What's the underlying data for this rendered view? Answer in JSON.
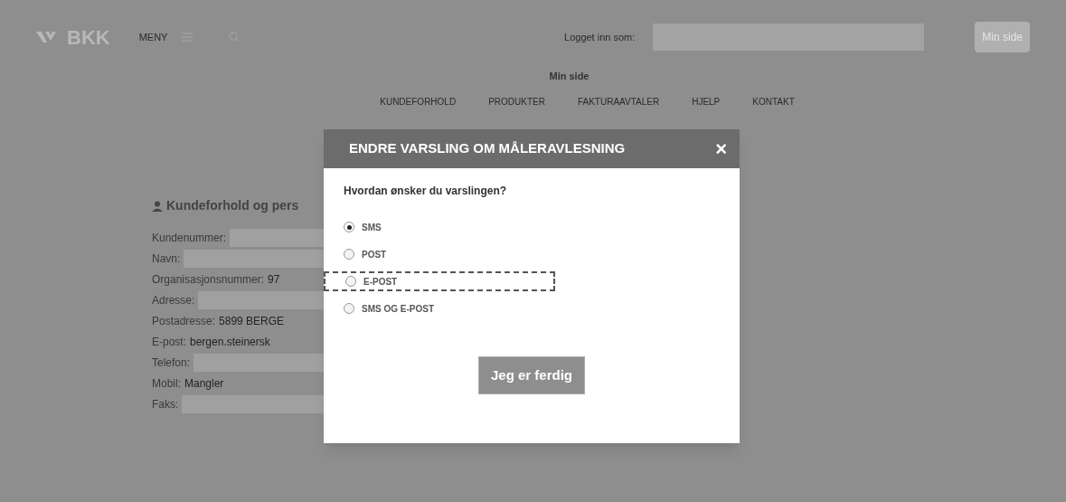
{
  "header": {
    "logo": "BKK",
    "menu": "MENY",
    "login_label": "Logget inn som:",
    "my_page": "Min side"
  },
  "breadcrumb": {
    "current": "Min side"
  },
  "nav": [
    "KUNDEFORHOLD",
    "PRODUKTER",
    "FAKTURAAVTALER",
    "HJELP",
    "KONTAKT"
  ],
  "customer": {
    "title": "Kundeforhold og pers",
    "fields": [
      {
        "label": "Kundenummer:",
        "redacted": true
      },
      {
        "label": "Navn:",
        "redacted": true
      },
      {
        "label": "Organisasjonsnummer:",
        "value": "97",
        "redacted": false
      },
      {
        "label": "Adresse:",
        "redacted": true
      },
      {
        "label": "Postadresse:",
        "value": "5899 BERGE",
        "redacted": false
      },
      {
        "label": "E-post:",
        "value": "bergen.steinersk",
        "redacted": false
      },
      {
        "label": "Telefon:",
        "redacted": true
      },
      {
        "label": "Mobil:",
        "value": "Mangler",
        "redacted": false
      },
      {
        "label": "Faks:",
        "redacted": true
      }
    ]
  },
  "modal": {
    "title": "ENDRE VARSLING OM MÅLERAVLESNING",
    "close": "×",
    "question": "Hvordan ønsker du varslingen?",
    "options": [
      {
        "label": "SMS",
        "selected": true,
        "highlighted": false
      },
      {
        "label": "POST",
        "selected": false,
        "highlighted": false
      },
      {
        "label": "E-POST",
        "selected": false,
        "highlighted": true
      },
      {
        "label": "SMS OG E-POST",
        "selected": false,
        "highlighted": false
      }
    ],
    "button": "Jeg er ferdig"
  }
}
